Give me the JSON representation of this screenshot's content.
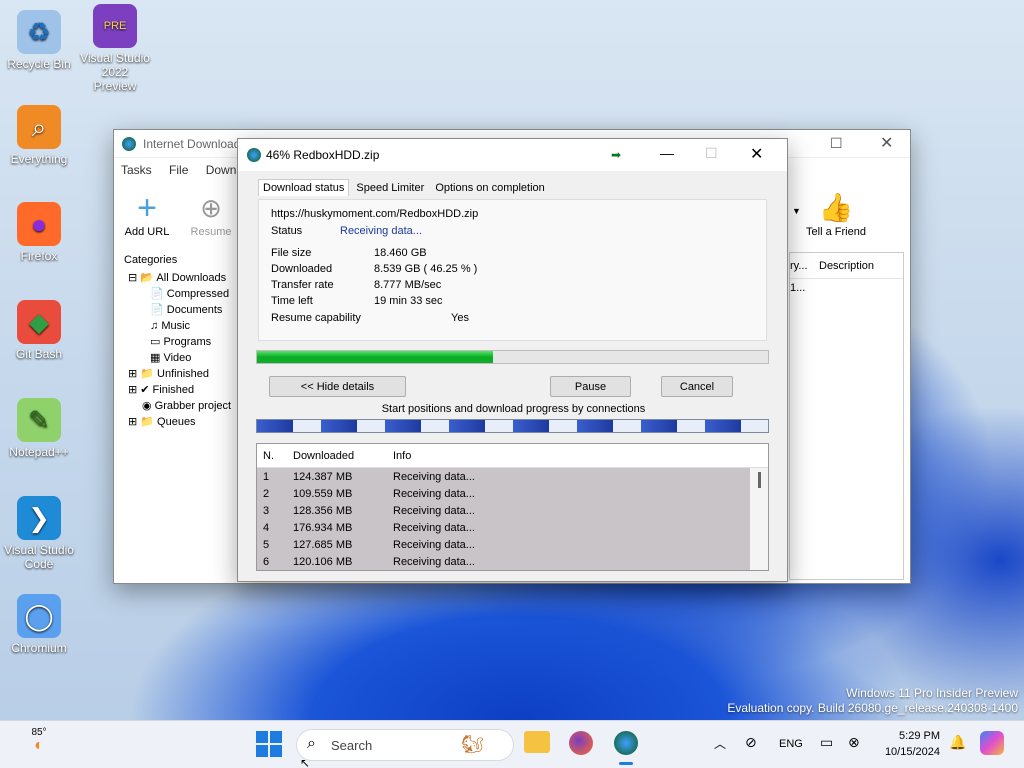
{
  "desktop": {
    "icons": [
      {
        "label": "Recycle Bin",
        "glyph": "♻",
        "bg": "#9fc3e8",
        "color": "#1f6fbf"
      },
      {
        "label": "Visual Studio 2022 Preview",
        "glyph": "PRE",
        "bg": "#7b3fbf",
        "color": "#ffd34d"
      },
      {
        "label": "Everything",
        "glyph": "⌕",
        "bg": "#f08a24",
        "color": "#fff"
      },
      {
        "label": "Firefox",
        "glyph": "●",
        "bg": "#ff6a2b",
        "color": "#8a2be2"
      },
      {
        "label": "Git Bash",
        "glyph": "◆",
        "bg": "#e94c3d",
        "color": "#2f9e44"
      },
      {
        "label": "Notepad++",
        "glyph": "✎",
        "bg": "#8fd16a",
        "color": "#2b6a17"
      },
      {
        "label": "Visual Studio Code",
        "glyph": "❯",
        "bg": "#1f8ad6",
        "color": "#fff"
      },
      {
        "label": "Chromium",
        "glyph": "◯",
        "bg": "#5aa0ee",
        "color": "#fff"
      }
    ],
    "watermark_line1": "Windows 11 Pro Insider Preview",
    "watermark_line2": "Evaluation copy. Build 26080.ge_release.240308-1400"
  },
  "idm": {
    "title": "Internet Download",
    "menu": [
      "Tasks",
      "File",
      "Downlo"
    ],
    "toolbar": {
      "add_url": "Add URL",
      "resume": "Resume",
      "tell_friend": "Tell a Friend"
    },
    "categories_label": "Categories",
    "tree": [
      "All Downloads",
      "Compressed",
      "Documents",
      "Music",
      "Programs",
      "Video",
      "Unfinished",
      "Finished",
      "Grabber project",
      "Queues"
    ],
    "cols": {
      "partial": "ry...",
      "description": "Description"
    },
    "partial_cell": "1..."
  },
  "dialog": {
    "title": "46% RedboxHDD.zip",
    "tabs": [
      "Download status",
      "Speed Limiter",
      "Options on completion"
    ],
    "url": "https://huskymoment.com/RedboxHDD.zip",
    "status_label": "Status",
    "status_value": "Receiving data...",
    "rows": [
      {
        "label": "File size",
        "value": "18.460  GB"
      },
      {
        "label": "Downloaded",
        "value": "8.539  GB  ( 46.25 % )"
      },
      {
        "label": "Transfer rate",
        "value": "8.777  MB/sec"
      },
      {
        "label": "Time left",
        "value": "19 min 33 sec"
      }
    ],
    "resume_label": "Resume capability",
    "resume_value": "Yes",
    "progress": 0.4625,
    "hide_details": "<< Hide details",
    "pause": "Pause",
    "cancel": "Cancel",
    "conn_caption": "Start positions and download progress by connections",
    "table_headers": [
      "N.",
      "Downloaded",
      "Info"
    ],
    "connections": [
      {
        "n": "1",
        "downloaded": "124.387  MB",
        "info": "Receiving data..."
      },
      {
        "n": "2",
        "downloaded": "109.559  MB",
        "info": "Receiving data..."
      },
      {
        "n": "3",
        "downloaded": "128.356  MB",
        "info": "Receiving data..."
      },
      {
        "n": "4",
        "downloaded": "176.934  MB",
        "info": "Receiving data..."
      },
      {
        "n": "5",
        "downloaded": "127.685  MB",
        "info": "Receiving data..."
      },
      {
        "n": "6",
        "downloaded": "120.106  MB",
        "info": "Receiving data..."
      }
    ]
  },
  "taskbar": {
    "weather": "85°",
    "search": "Search",
    "lang": "ENG",
    "time": "5:29 PM",
    "date": "10/15/2024"
  }
}
